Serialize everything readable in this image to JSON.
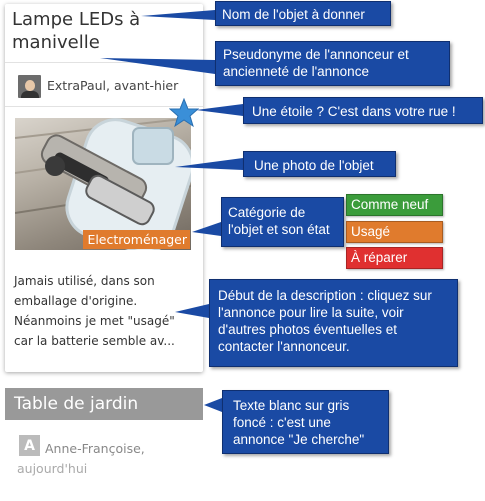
{
  "ad_card": {
    "title": "Lampe LEDs à manivelle",
    "author_line": "ExtraPaul, avant-hier",
    "category": "Electroménager",
    "description": "Jamais utilisé, dans son emballage d'origine. Néanmoins je met \"usagé\" car la batterie semble av..."
  },
  "search_card": {
    "title": "Table de jardin",
    "avatar_letter": "A",
    "author": "Anne-Françoise,",
    "date": "aujourd'hui"
  },
  "callouts": {
    "name": "Nom de l'objet à donner",
    "author": "Pseudonyme de l'annonceur et ancienneté de l'annonce",
    "star": "Une étoile ? C'est dans votre rue !",
    "photo": "Une photo de l'objet",
    "category": "Catégorie de l'objet et son état",
    "description": "Début de la description : cliquez sur l'annonce pour lire la suite, voir d'autres photos éventuelles et contacter l'annonceur.",
    "search": "Texte blanc sur gris foncé : c'est une annonce \"Je cherche\""
  },
  "states": [
    {
      "label": "Comme neuf",
      "color": "#3b9c3b"
    },
    {
      "label": "Usagé",
      "color": "#e07b2d"
    },
    {
      "label": "À réparer",
      "color": "#e03030"
    }
  ],
  "colors": {
    "callout_bg": "#1a4aa4",
    "star": "#3a8fd8",
    "search_title_bg": "#999999"
  },
  "icons": {
    "star": "star-icon",
    "avatar": "user-avatar"
  }
}
